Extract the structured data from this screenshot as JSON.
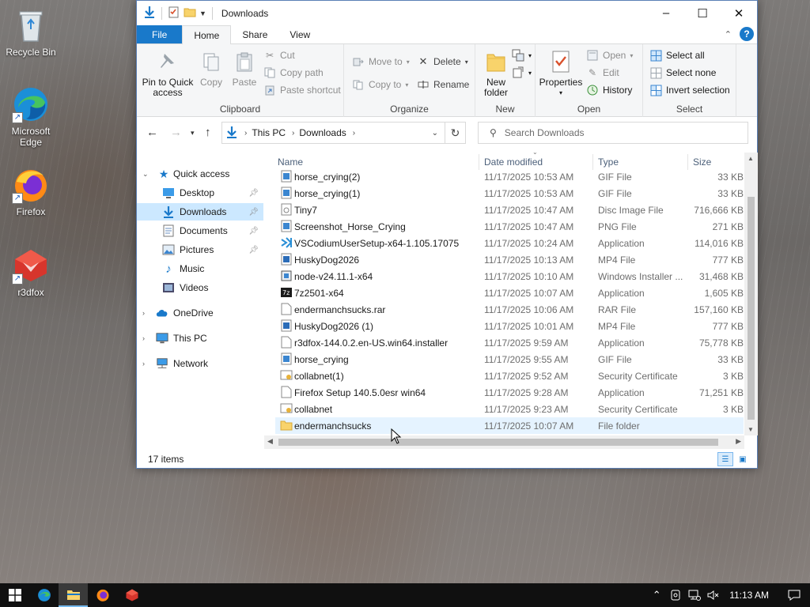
{
  "desktop": {
    "icons": [
      {
        "label": "Recycle Bin",
        "icon": "recycle-bin-icon"
      },
      {
        "label": "Microsoft Edge",
        "icon": "edge-icon"
      },
      {
        "label": "Firefox",
        "icon": "firefox-icon"
      },
      {
        "label": "r3dfox",
        "icon": "r3dfox-icon"
      }
    ]
  },
  "window": {
    "title": "Downloads",
    "controls": {
      "minimize": "–",
      "maximize": "☐",
      "close": "✕"
    }
  },
  "ribbon": {
    "tabs": [
      "File",
      "Home",
      "Share",
      "View"
    ],
    "active_tab": "Home",
    "groups": {
      "clipboard": {
        "label": "Clipboard",
        "pin": "Pin to Quick access",
        "copy": "Copy",
        "paste": "Paste",
        "cut": "Cut",
        "copy_path": "Copy path",
        "paste_shortcut": "Paste shortcut"
      },
      "organize": {
        "label": "Organize",
        "move_to": "Move to",
        "copy_to": "Copy to",
        "delete": "Delete",
        "rename": "Rename"
      },
      "new": {
        "label": "New",
        "new_folder": "New folder"
      },
      "open": {
        "label": "Open",
        "properties": "Properties",
        "open": "Open",
        "edit": "Edit",
        "history": "History"
      },
      "select": {
        "label": "Select",
        "select_all": "Select all",
        "select_none": "Select none",
        "invert": "Invert selection"
      }
    }
  },
  "address": {
    "crumbs": [
      "This PC",
      "Downloads"
    ],
    "search_placeholder": "Search Downloads"
  },
  "nav": {
    "items": [
      {
        "label": "Quick access",
        "icon": "star-icon",
        "pinned": false
      },
      {
        "label": "Desktop",
        "icon": "desktop-icon",
        "pinned": true
      },
      {
        "label": "Downloads",
        "icon": "download-icon",
        "pinned": true
      },
      {
        "label": "Documents",
        "icon": "documents-icon",
        "pinned": true
      },
      {
        "label": "Pictures",
        "icon": "pictures-icon",
        "pinned": true
      },
      {
        "label": "Music",
        "icon": "music-icon",
        "pinned": false
      },
      {
        "label": "Videos",
        "icon": "videos-icon",
        "pinned": false
      },
      {
        "label": "OneDrive",
        "icon": "cloud-icon",
        "pinned": false
      },
      {
        "label": "This PC",
        "icon": "computer-icon",
        "pinned": false
      },
      {
        "label": "Network",
        "icon": "network-icon",
        "pinned": false
      }
    ]
  },
  "files": {
    "columns": {
      "name": "Name",
      "date": "Date modified",
      "type": "Type",
      "size": "Size"
    },
    "rows": [
      {
        "name": "horse_crying(2)",
        "date": "11/17/2025 10:53 AM",
        "type": "GIF File",
        "size": "33 KB",
        "icon": "image-file-icon"
      },
      {
        "name": "horse_crying(1)",
        "date": "11/17/2025 10:53 AM",
        "type": "GIF File",
        "size": "33 KB",
        "icon": "image-file-icon"
      },
      {
        "name": "Tiny7",
        "date": "11/17/2025 10:47 AM",
        "type": "Disc Image File",
        "size": "716,666 KB",
        "icon": "disc-image-icon"
      },
      {
        "name": "Screenshot_Horse_Crying",
        "date": "11/17/2025 10:47 AM",
        "type": "PNG File",
        "size": "271 KB",
        "icon": "image-file-icon"
      },
      {
        "name": "VSCodiumUserSetup-x64-1.105.17075",
        "date": "11/17/2025 10:24 AM",
        "type": "Application",
        "size": "114,016 KB",
        "icon": "vscodium-icon"
      },
      {
        "name": "HuskyDog2026",
        "date": "11/17/2025 10:13 AM",
        "type": "MP4 File",
        "size": "777 KB",
        "icon": "video-file-icon"
      },
      {
        "name": "node-v24.11.1-x64",
        "date": "11/17/2025 10:10 AM",
        "type": "Windows Installer ...",
        "size": "31,468 KB",
        "icon": "installer-icon"
      },
      {
        "name": "7z2501-x64",
        "date": "11/17/2025 10:07 AM",
        "type": "Application",
        "size": "1,605 KB",
        "icon": "7zip-icon"
      },
      {
        "name": "endermanchsucks.rar",
        "date": "11/17/2025 10:06 AM",
        "type": "RAR File",
        "size": "157,160 KB",
        "icon": "blank-file-icon"
      },
      {
        "name": "HuskyDog2026 (1)",
        "date": "11/17/2025 10:01 AM",
        "type": "MP4 File",
        "size": "777 KB",
        "icon": "video-file-icon"
      },
      {
        "name": "r3dfox-144.0.2.en-US.win64.installer",
        "date": "11/17/2025 9:59 AM",
        "type": "Application",
        "size": "75,778 KB",
        "icon": "blank-file-icon"
      },
      {
        "name": "horse_crying",
        "date": "11/17/2025 9:55 AM",
        "type": "GIF File",
        "size": "33 KB",
        "icon": "image-file-icon"
      },
      {
        "name": "collabnet(1)",
        "date": "11/17/2025 9:52 AM",
        "type": "Security Certificate",
        "size": "3 KB",
        "icon": "certificate-icon"
      },
      {
        "name": "Firefox Setup 140.5.0esr win64",
        "date": "11/17/2025 9:28 AM",
        "type": "Application",
        "size": "71,251 KB",
        "icon": "blank-file-icon"
      },
      {
        "name": "collabnet",
        "date": "11/17/2025 9:23 AM",
        "type": "Security Certificate",
        "size": "3 KB",
        "icon": "certificate-icon"
      },
      {
        "name": "endermanchsucks",
        "date": "11/17/2025 10:07 AM",
        "type": "File folder",
        "size": "",
        "icon": "folder-icon"
      }
    ]
  },
  "status": {
    "item_count": "17 items"
  },
  "taskbar": {
    "apps": [
      "start-icon",
      "edge-icon",
      "file-explorer-icon",
      "firefox-icon",
      "r3dfox-icon"
    ],
    "clock": "11:13 AM"
  },
  "colors": {
    "accent": "#1979ca",
    "selection": "#cce8ff",
    "hover_row": "#e5f3ff",
    "taskbar": "#101010"
  }
}
